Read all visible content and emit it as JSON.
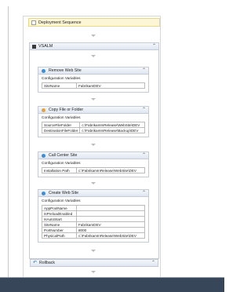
{
  "sequence": {
    "title": "Deployment Sequence"
  },
  "vsalm": {
    "title": "VSALM"
  },
  "activities": [
    {
      "title": "Remove Web Site",
      "config_label": "Configuration Variables",
      "rows": [
        {
          "key": "SiteName",
          "value": "FabrikamDEV"
        }
      ]
    },
    {
      "title": "Copy File or Folder",
      "config_label": "Configuration Variables",
      "rows": [
        {
          "key": "SourceFileFolder",
          "value": "c:\\FabrikamInRelease\\WebSite\\DEV"
        },
        {
          "key": "DestinationFileFolder",
          "value": "c:\\FabrikamInRelease\\Backup\\DEV"
        }
      ]
    },
    {
      "title": "Call Center Site",
      "config_label": "Configuration Variables",
      "rows": [
        {
          "key": "Installation Path",
          "value": "c:\\FabrikamInRelease\\WebSite\\DEV"
        }
      ]
    },
    {
      "title": "Create Web Site",
      "config_label": "Configuration Variables",
      "rows": [
        {
          "key": "AppPoolName",
          "value": ""
        },
        {
          "key": "IsPreloadEnabled",
          "value": ""
        },
        {
          "key": "IsAutoStart",
          "value": ""
        },
        {
          "key": "SiteName",
          "value": "FabrikamDEV"
        },
        {
          "key": "PortNumber",
          "value": "8000"
        },
        {
          "key": "PhysicalPath",
          "value": "c:\\FabrikamInRelease\\WebSite\\DEV"
        }
      ]
    }
  ],
  "rollback": {
    "title": "Rollback"
  },
  "icons": {
    "sequence": "sequence-icon",
    "vsalm": "server-icon",
    "activity_colors": [
      "#3c8fd6",
      "#e6a23c",
      "#3c8fd6",
      "#3c8fd6"
    ],
    "collapse": "double-chevron-up-icon",
    "rollback": "rollback-icon"
  }
}
